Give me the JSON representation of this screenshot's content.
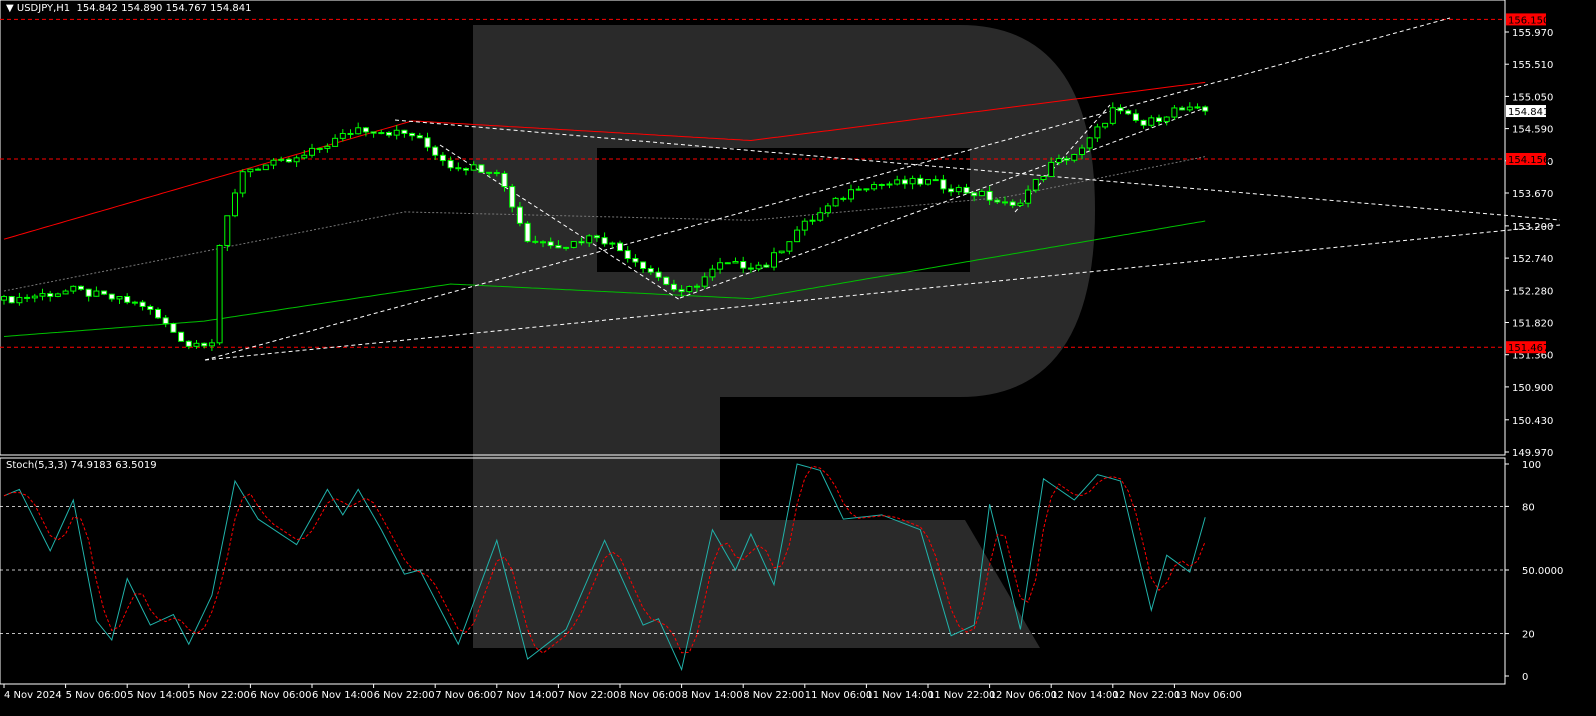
{
  "header": {
    "symbol": "USDJPY,H1",
    "ohlc": "154.842 154.890 154.767 154.841"
  },
  "stoch_header": {
    "name": "Stoch(5,3,3)",
    "values": "74.9183 63.5019"
  },
  "colors": {
    "bg": "#000000",
    "candle": "#00ff00",
    "ma_red": "#ff0000",
    "ma_green": "#00c000",
    "stoch_main": "#20b2aa",
    "stoch_signal": "#ff0000",
    "level_line": "#ff0000",
    "watermark": "#2a2a2a"
  },
  "chart_data": [
    {
      "type": "candlestick",
      "title": "USDJPY,H1",
      "ylim": [
        149.97,
        156.15
      ],
      "y_ticks": [
        "155.970",
        "155.510",
        "155.050",
        "154.590",
        "154.130",
        "153.670",
        "153.200",
        "152.740",
        "152.280",
        "151.820",
        "151.360",
        "150.900",
        "150.430",
        "149.970"
      ],
      "current_price": "154.841",
      "levels": [
        "156.150",
        "154.156",
        "151.467"
      ],
      "x_ticks": [
        "4 Nov 2024",
        "5 Nov 06:00",
        "5 Nov 14:00",
        "5 Nov 22:00",
        "6 Nov 06:00",
        "6 Nov 14:00",
        "6 Nov 22:00",
        "7 Nov 06:00",
        "7 Nov 14:00",
        "7 Nov 22:00",
        "8 Nov 06:00",
        "8 Nov 14:00",
        "8 Nov 22:00",
        "11 Nov 06:00",
        "11 Nov 14:00",
        "11 Nov 22:00",
        "12 Nov 06:00",
        "12 Nov 14:00",
        "12 Nov 22:00",
        "13 Nov 06:00"
      ],
      "bars": 157,
      "close_path": [
        [
          0,
          152.14
        ],
        [
          9,
          152.28
        ],
        [
          18,
          152.07
        ],
        [
          24,
          151.5
        ],
        [
          27,
          151.57
        ],
        [
          28,
          152.93
        ],
        [
          31,
          154.0
        ],
        [
          38,
          154.14
        ],
        [
          46,
          154.6
        ],
        [
          53,
          154.5
        ],
        [
          58,
          154.07
        ],
        [
          64,
          154.0
        ],
        [
          68,
          153.0
        ],
        [
          73,
          152.93
        ],
        [
          77,
          153.07
        ],
        [
          83,
          152.64
        ],
        [
          88,
          152.21
        ],
        [
          93,
          152.64
        ],
        [
          99,
          152.64
        ],
        [
          103,
          153.14
        ],
        [
          111,
          153.78
        ],
        [
          120,
          153.83
        ],
        [
          127,
          153.64
        ],
        [
          131,
          153.46
        ],
        [
          136,
          154.07
        ],
        [
          140,
          154.28
        ],
        [
          144,
          154.86
        ],
        [
          148,
          154.64
        ],
        [
          152,
          154.86
        ],
        [
          156,
          154.841
        ]
      ],
      "ma_red": [
        [
          0,
          153.01
        ],
        [
          53,
          154.7
        ],
        [
          97,
          154.42
        ],
        [
          156,
          155.25
        ]
      ],
      "ma_grey": [
        [
          0,
          152.27
        ],
        [
          52,
          153.4
        ],
        [
          97,
          153.28
        ],
        [
          130,
          153.61
        ],
        [
          156,
          154.19
        ]
      ],
      "ma_green": [
        [
          0,
          151.62
        ],
        [
          26,
          151.84
        ],
        [
          58,
          152.37
        ],
        [
          97,
          152.16
        ],
        [
          156,
          153.27
        ]
      ]
    },
    {
      "type": "line",
      "title": "Stoch(5,3,3)",
      "ylim": [
        0,
        100
      ],
      "y_ticks": [
        "100",
        "80",
        "50.0000",
        "20",
        "0"
      ],
      "levels": [
        80,
        50,
        20
      ],
      "main_last": 74.9183,
      "signal_last": 63.5019,
      "main": [
        [
          0,
          85
        ],
        [
          2,
          88
        ],
        [
          6,
          59
        ],
        [
          9,
          83
        ],
        [
          12,
          26
        ],
        [
          14,
          17
        ],
        [
          16,
          46
        ],
        [
          19,
          24
        ],
        [
          22,
          29
        ],
        [
          24,
          15
        ],
        [
          27,
          38
        ],
        [
          30,
          92
        ],
        [
          33,
          74
        ],
        [
          38,
          62
        ],
        [
          42,
          88
        ],
        [
          44,
          76
        ],
        [
          46,
          88
        ],
        [
          49,
          69
        ],
        [
          52,
          48
        ],
        [
          54,
          50
        ],
        [
          59,
          15
        ],
        [
          64,
          64
        ],
        [
          68,
          8
        ],
        [
          73,
          22
        ],
        [
          78,
          64
        ],
        [
          83,
          24
        ],
        [
          85,
          27
        ],
        [
          88,
          3
        ],
        [
          92,
          69
        ],
        [
          95,
          50
        ],
        [
          97,
          67
        ],
        [
          100,
          43
        ],
        [
          103,
          100
        ],
        [
          106,
          97
        ],
        [
          109,
          74
        ],
        [
          114,
          76
        ],
        [
          119,
          69
        ],
        [
          123,
          19
        ],
        [
          126,
          24
        ],
        [
          128,
          81
        ],
        [
          132,
          22
        ],
        [
          135,
          93
        ],
        [
          139,
          83
        ],
        [
          142,
          95
        ],
        [
          145,
          92
        ],
        [
          149,
          31
        ],
        [
          151,
          57
        ],
        [
          154,
          49
        ],
        [
          156,
          74.92
        ]
      ]
    }
  ]
}
